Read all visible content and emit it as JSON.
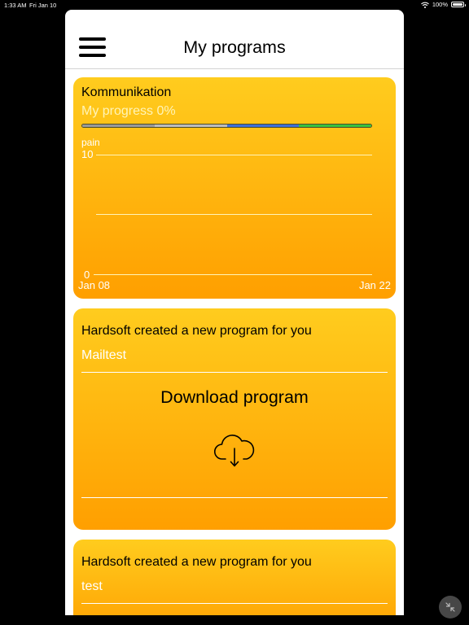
{
  "status_bar": {
    "time": "1:33 AM",
    "date": "Fri Jan 10",
    "battery": "100%"
  },
  "header": {
    "title": "My programs"
  },
  "program_card": {
    "title": "Kommunikation",
    "progress_text": "My progress 0%",
    "progress_percent": 0,
    "progress_segment_colors": [
      "#9a9a9a",
      "#bdbdbd",
      "#3e6fd6",
      "#39c23e"
    ],
    "chart_data": {
      "type": "line",
      "ylabel": "pain",
      "ylim": [
        0,
        10
      ],
      "y_ticks": [
        "10",
        "0"
      ],
      "x_ticks": [
        "Jan 08",
        "Jan 22"
      ],
      "series": []
    }
  },
  "notifications": [
    {
      "message": "Hardsoft created a new program for you",
      "program_name": "Mailtest",
      "action_label": "Download program",
      "icon": "cloud-download-icon"
    },
    {
      "message": "Hardsoft created a new program for you",
      "program_name": "test"
    }
  ],
  "colors": {
    "card_top": "#ffcc1e",
    "card_bottom": "#ff9f00",
    "sheet": "#ffffff",
    "backdrop": "#000000"
  }
}
